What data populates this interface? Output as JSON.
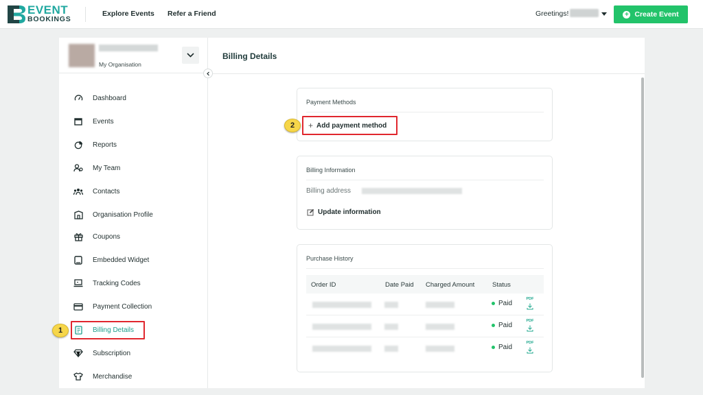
{
  "header": {
    "logo_line1": "EVENT",
    "logo_line2": "BOOKINGS",
    "nav": [
      "Explore Events",
      "Refer a Friend"
    ],
    "greeting": "Greetings!",
    "create_button": "Create Event"
  },
  "sidebar": {
    "org_subtitle": "My Organisation",
    "items": [
      {
        "label": "Dashboard",
        "icon": "speedometer-icon"
      },
      {
        "label": "Events",
        "icon": "calendar-icon"
      },
      {
        "label": "Reports",
        "icon": "pie-chart-icon"
      },
      {
        "label": "My Team",
        "icon": "team-icon"
      },
      {
        "label": "Contacts",
        "icon": "contacts-icon"
      },
      {
        "label": "Organisation Profile",
        "icon": "organisation-icon"
      },
      {
        "label": "Coupons",
        "icon": "gift-icon"
      },
      {
        "label": "Embedded Widget",
        "icon": "widget-icon"
      },
      {
        "label": "Tracking Codes",
        "icon": "laptop-icon"
      },
      {
        "label": "Payment Collection",
        "icon": "credit-card-icon"
      },
      {
        "label": "Billing Details",
        "icon": "invoice-icon",
        "active": true
      },
      {
        "label": "Subscription",
        "icon": "diamond-icon"
      },
      {
        "label": "Merchandise",
        "icon": "tshirt-icon"
      }
    ]
  },
  "content": {
    "title": "Billing Details",
    "payment_methods": {
      "title": "Payment Methods",
      "add_label": "Add payment method"
    },
    "billing_information": {
      "title": "Billing Information",
      "address_label": "Billing address",
      "update_label": "Update information"
    },
    "purchase_history": {
      "title": "Purchase History",
      "columns": [
        "Order ID",
        "Date Paid",
        "Charged Amount",
        "Status"
      ],
      "rows": [
        {
          "status": "Paid",
          "download": "PDF"
        },
        {
          "status": "Paid",
          "download": "PDF"
        },
        {
          "status": "Paid",
          "download": "PDF"
        }
      ]
    }
  },
  "annotations": {
    "step1": "1",
    "step2": "2",
    "highlight_color": "#e0262d",
    "badge_color": "#f6d64a"
  },
  "colors": {
    "accent_green": "#22c36a",
    "accent_teal": "#1e9e8c"
  }
}
